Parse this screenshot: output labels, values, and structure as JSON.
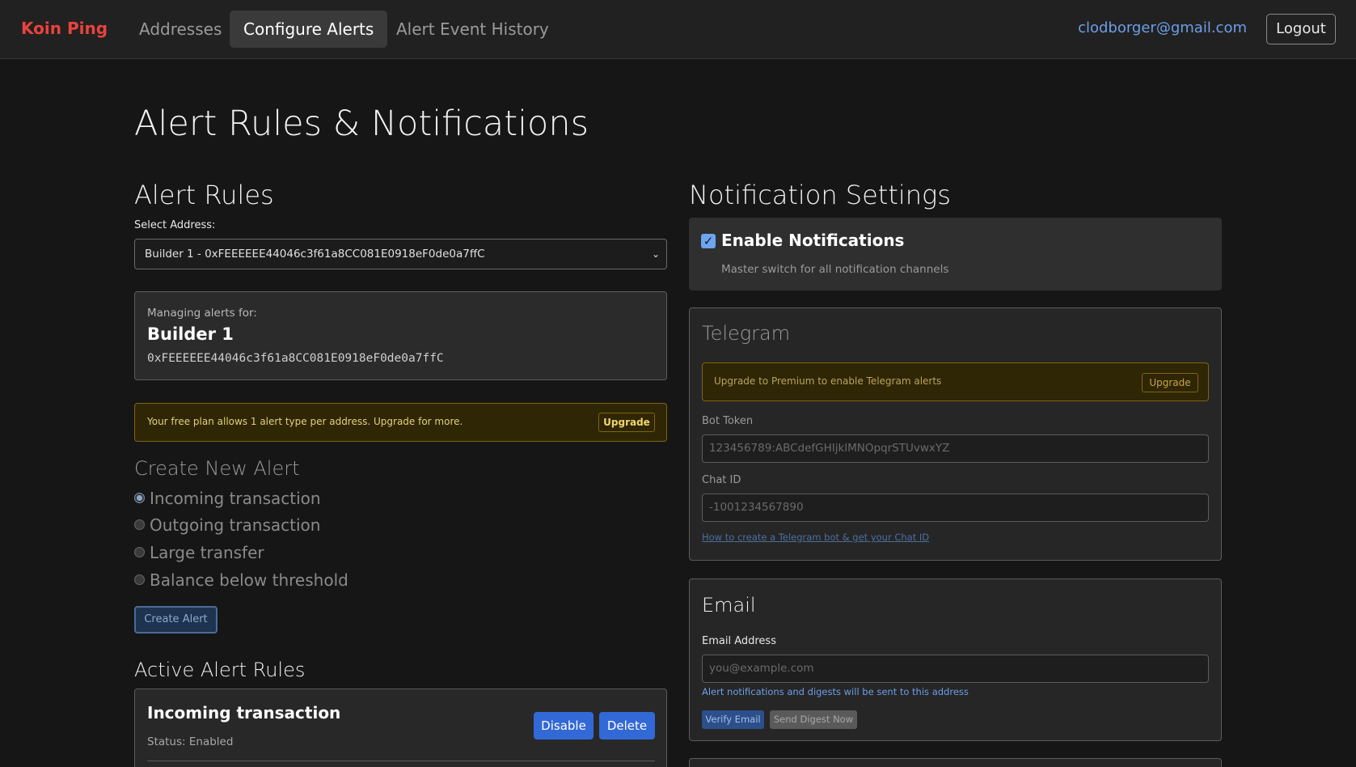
{
  "nav": {
    "brand": "Koin Ping",
    "links": [
      "Addresses",
      "Configure Alerts",
      "Alert Event History"
    ],
    "user_email": "clodborger@gmail.com",
    "logout_label": "Logout"
  },
  "page": {
    "title": "Alert Rules & Notifications"
  },
  "alert_rules": {
    "title": "Alert Rules",
    "select_label": "Select Address:",
    "selected_address": "Builder 1 - 0xFEEEEEE44046c3f61a8CC081E0918eF0de0a7ffC",
    "managing_label": "Managing alerts for:",
    "managing_name": "Builder 1",
    "managing_address": "0xFEEEEEE44046c3f61a8CC081E0918eF0de0a7ffC",
    "plan_warning": "Your free plan allows 1 alert type per address. Upgrade for more.",
    "upgrade_label": "Upgrade",
    "create_title": "Create New Alert",
    "alert_types": [
      "Incoming transaction",
      "Outgoing transaction",
      "Large transfer",
      "Balance below threshold"
    ],
    "selected_type_index": 0,
    "create_button": "Create Alert",
    "active_title": "Active Alert Rules",
    "active_rules": [
      {
        "name": "Incoming transaction",
        "status": "Status: Enabled",
        "disable_label": "Disable",
        "delete_label": "Delete"
      }
    ]
  },
  "notifications": {
    "title": "Notification Settings",
    "enable_label": "Enable Notifications",
    "enable_checked": true,
    "enable_sub": "Master switch for all notification channels",
    "telegram": {
      "title": "Telegram",
      "upgrade_text": "Upgrade to Premium to enable Telegram alerts",
      "upgrade_label": "Upgrade",
      "bot_token_label": "Bot Token",
      "bot_token_placeholder": "123456789:ABCdefGHIjklMNOpqrSTUvwxYZ",
      "chat_id_label": "Chat ID",
      "chat_id_placeholder": "-1001234567890",
      "help_link": "How to create a Telegram bot & get your Chat ID"
    },
    "email": {
      "title": "Email",
      "address_label": "Email Address",
      "address_placeholder": "you@example.com",
      "help_text": "Alert notifications and digests will be sent to this address",
      "verify_label": "Verify Email",
      "digest_label": "Send Digest Now"
    }
  },
  "colors": {
    "brand": "#e8433d",
    "primary": "#3369d6",
    "warning_bg": "#2f2605",
    "link": "#6d9ee8"
  }
}
